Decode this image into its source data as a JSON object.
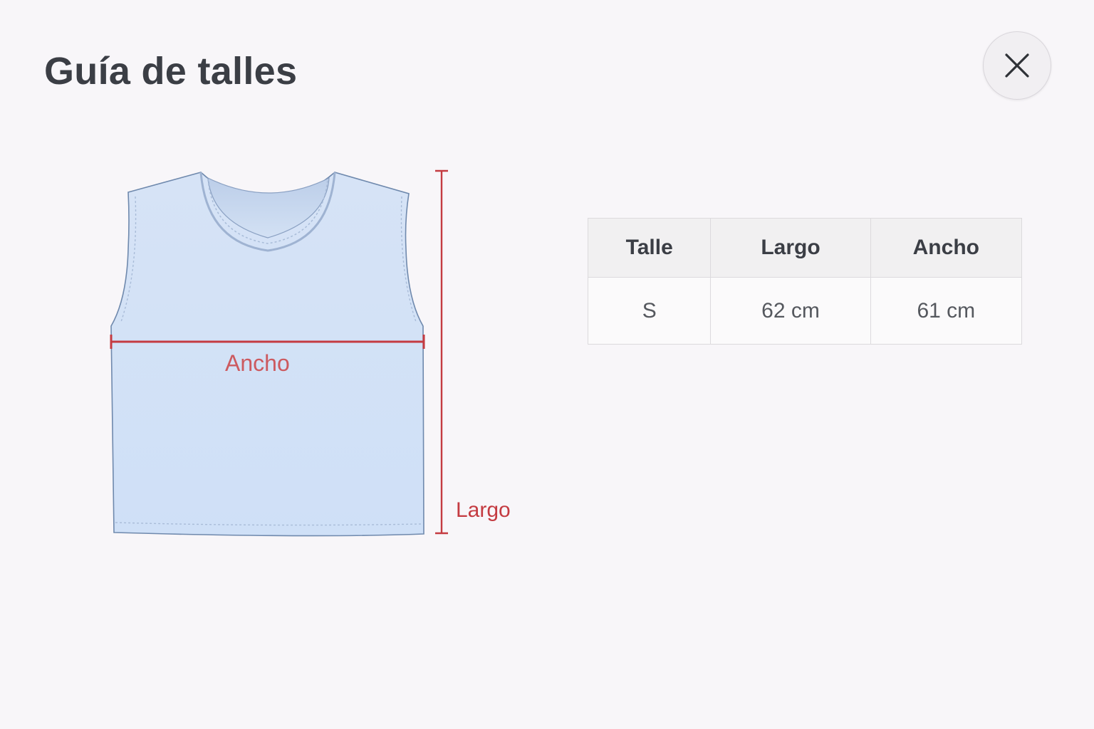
{
  "header": {
    "title": "Guía de talles"
  },
  "close": {
    "icon": "close-icon"
  },
  "diagram": {
    "garment": "tank-top",
    "width_label": "Ancho",
    "length_label": "Largo",
    "measure_color": "#c43b41",
    "garment_color": "#cfe0f7"
  },
  "size_table": {
    "headers": [
      "Talle",
      "Largo",
      "Ancho"
    ],
    "rows": [
      [
        "S",
        "62 cm",
        "61 cm"
      ]
    ]
  }
}
